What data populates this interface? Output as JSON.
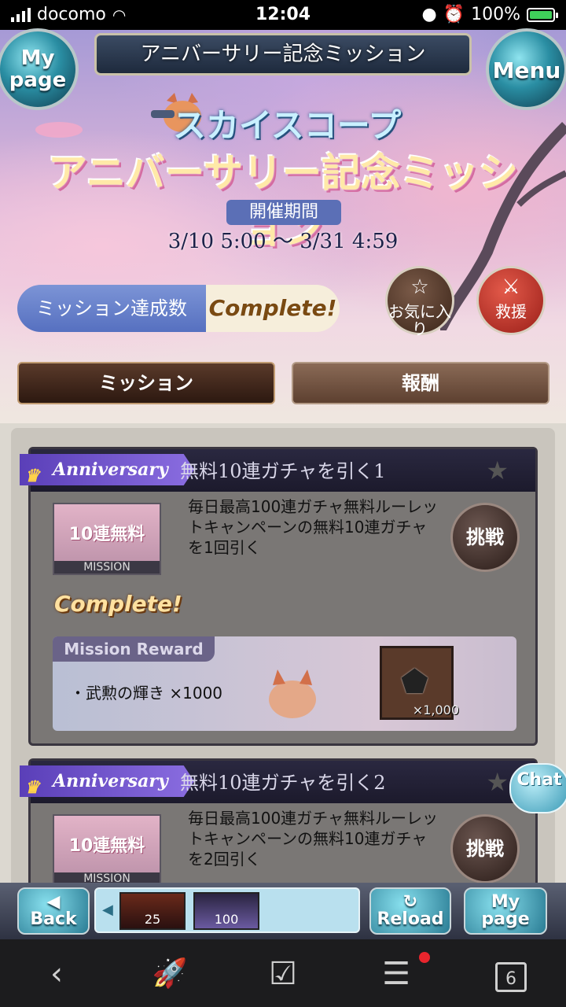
{
  "status_bar": {
    "carrier": "docomo",
    "time": "12:04",
    "battery": "100%"
  },
  "header": {
    "title": "アニバーサリー記念ミッション",
    "mypage_line1": "My",
    "mypage_line2": "page",
    "menu_label": "Menu"
  },
  "event": {
    "brand": "スカイスコープ",
    "title": "アニバーサリー記念ミッション",
    "period_label": "開催期間",
    "period": "3/10 5:00 〜 3/31 4:59",
    "count_label": "ミッション達成数",
    "count_value": "Complete!",
    "favorite_label": "お気に入り",
    "rescue_label": "救援"
  },
  "tabs": [
    {
      "label": "ミッション",
      "active": true
    },
    {
      "label": "報酬",
      "active": false
    }
  ],
  "missions": [
    {
      "badge": "Anniversary",
      "title": "無料10連ガチャを引く1",
      "thumb_text": "10連無料",
      "thumb_caption": "MISSION",
      "description": "毎日最高100連ガチャ無料ルーレットキャンペーンの無料10連ガチャを1回引く",
      "challenge_label": "挑戦",
      "status": "Complete!",
      "reward_label": "Mission Reward",
      "reward_item": "・武勲の輝き ×1000",
      "reward_qty": "×1,000"
    },
    {
      "badge": "Anniversary",
      "title": "無料10連ガチャを引く2",
      "thumb_text": "10連無料",
      "thumb_caption": "MISSION",
      "description": "毎日最高100連ガチャ無料ルーレットキャンペーンの無料10連ガチャを2回引く",
      "challenge_label": "挑戦"
    }
  ],
  "chat_label": "Chat",
  "bottom_bar": {
    "back_label": "Back",
    "reload_label": "Reload",
    "mypage_line1": "My",
    "mypage_line2": "page",
    "tray": [
      {
        "count": "25"
      },
      {
        "count": "100"
      }
    ]
  },
  "browser_nav": {
    "tab_count": "6"
  },
  "colors": {
    "accent": "#5670c0",
    "complete": "#ffe1a0",
    "rescue": "#c23a2e",
    "notification": "#e8252d"
  }
}
